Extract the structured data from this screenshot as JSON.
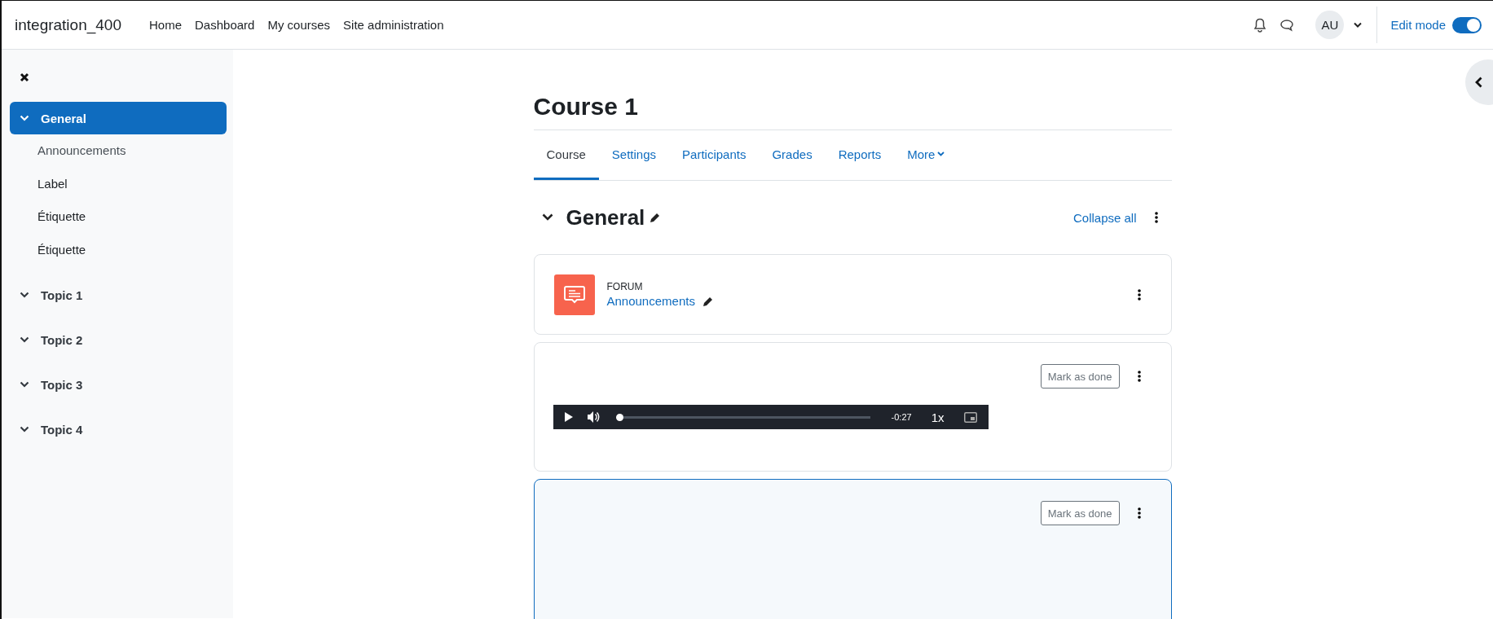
{
  "navbar": {
    "site_name": "integration_400",
    "links": [
      "Home",
      "Dashboard",
      "My courses",
      "Site administration"
    ],
    "avatar_initials": "AU",
    "edit_mode": {
      "label": "Edit mode",
      "on": true
    }
  },
  "sidebar": {
    "items": [
      {
        "label": "General",
        "selected": true,
        "expanded": true,
        "children": [
          {
            "label": "Announcements",
            "dimmed": true
          },
          {
            "label": "Label",
            "dimmed": false
          },
          {
            "label": "Étiquette",
            "dimmed": false
          },
          {
            "label": "Étiquette",
            "dimmed": false
          }
        ]
      },
      {
        "label": "Topic 1",
        "selected": false,
        "expanded": true
      },
      {
        "label": "Topic 2",
        "selected": false,
        "expanded": true
      },
      {
        "label": "Topic 3",
        "selected": false,
        "expanded": true
      },
      {
        "label": "Topic 4",
        "selected": false,
        "expanded": true
      }
    ]
  },
  "course": {
    "title": "Course 1",
    "tabs": [
      {
        "label": "Course",
        "selected": true
      },
      {
        "label": "Settings",
        "selected": false
      },
      {
        "label": "Participants",
        "selected": false
      },
      {
        "label": "Grades",
        "selected": false
      },
      {
        "label": "Reports",
        "selected": false
      },
      {
        "label": "More",
        "selected": false,
        "dropdown": true
      }
    ]
  },
  "section": {
    "title": "General",
    "expanded": true,
    "collapse_link": "Collapse all",
    "activities": [
      {
        "kind": "forum",
        "type_label": "FORUM",
        "name": "Announcements",
        "selected": false
      },
      {
        "kind": "media",
        "button": "Mark as done",
        "time": "-0:27",
        "speed": "1x",
        "level": 0,
        "selected": false
      },
      {
        "kind": "label",
        "button": "Mark as done",
        "selected": true
      }
    ]
  }
}
